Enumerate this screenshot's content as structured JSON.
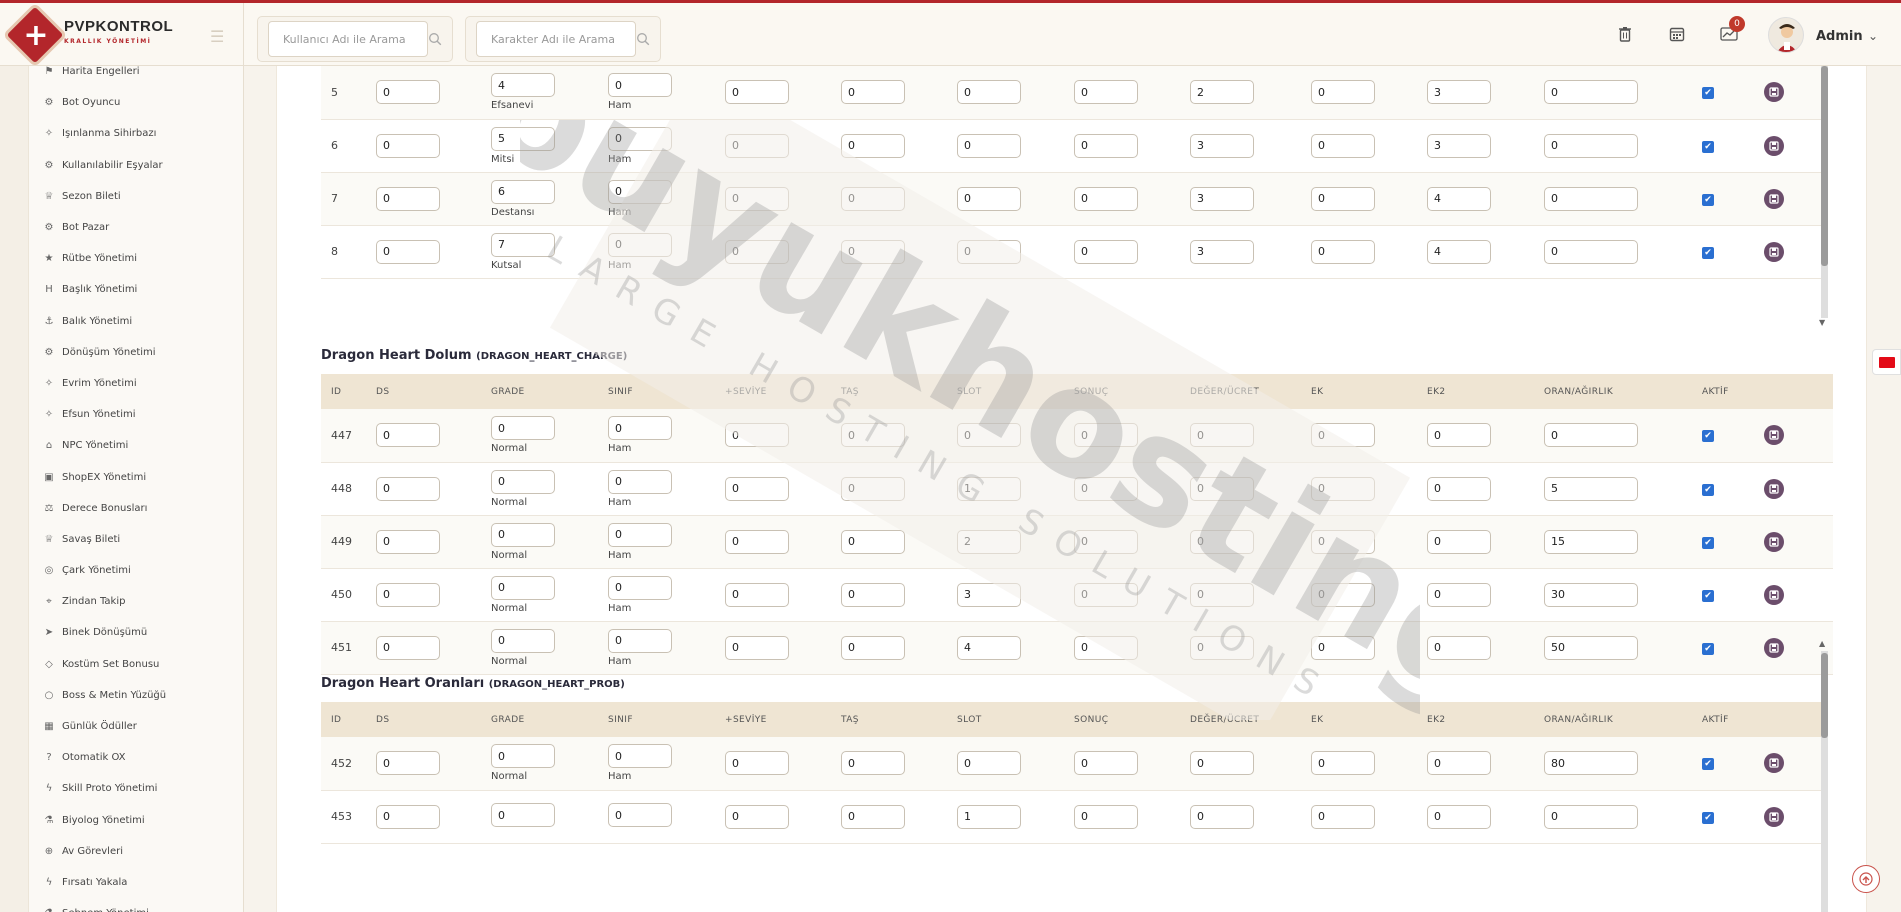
{
  "brand": {
    "name": "PVPKONTROL",
    "subtitle": "KRALLIK YÖNETİMİ"
  },
  "header": {
    "search_user_placeholder": "Kullanıcı Adı ile Arama",
    "search_char_placeholder": "Karakter Adı ile Arama",
    "notification_count": "0",
    "admin_name": "Admin"
  },
  "sidebar": {
    "items": [
      {
        "label": "Harita Engelleri",
        "icon": "map-icon"
      },
      {
        "label": "Bot Oyuncu",
        "icon": "robot-icon"
      },
      {
        "label": "Işınlanma Sihirbazı",
        "icon": "wand-icon"
      },
      {
        "label": "Kullanılabilir Eşyalar",
        "icon": "cogs-icon"
      },
      {
        "label": "Sezon Bileti",
        "icon": "trophy-icon"
      },
      {
        "label": "Bot Pazar",
        "icon": "robot-icon"
      },
      {
        "label": "Rütbe Yönetimi",
        "icon": "star-icon"
      },
      {
        "label": "Başlık Yönetimi",
        "icon": "heading-icon"
      },
      {
        "label": "Balık Yönetimi",
        "icon": "anchor-icon"
      },
      {
        "label": "Dönüşüm Yönetimi",
        "icon": "cogs-icon"
      },
      {
        "label": "Evrim Yönetimi",
        "icon": "wand-icon"
      },
      {
        "label": "Efsun Yönetimi",
        "icon": "wand-icon"
      },
      {
        "label": "NPC Yönetimi",
        "icon": "bank-icon"
      },
      {
        "label": "ShopEX Yönetimi",
        "icon": "cube-icon"
      },
      {
        "label": "Derece Bonusları",
        "icon": "scale-icon"
      },
      {
        "label": "Savaş Bileti",
        "icon": "trophy-icon"
      },
      {
        "label": "Çark Yönetimi",
        "icon": "wheel-icon"
      },
      {
        "label": "Zindan Takip",
        "icon": "pin-icon"
      },
      {
        "label": "Binek Dönüşümü",
        "icon": "rocket-icon"
      },
      {
        "label": "Kostüm Set Bonusu",
        "icon": "gem-icon"
      },
      {
        "label": "Boss & Metin Yüzüğü",
        "icon": "ring-icon"
      },
      {
        "label": "Günlük Ödüller",
        "icon": "calendar-icon"
      },
      {
        "label": "Otomatik OX",
        "icon": "question-icon"
      },
      {
        "label": "Skill Proto Yönetimi",
        "icon": "bolt-icon"
      },
      {
        "label": "Biyolog Yönetimi",
        "icon": "flask-icon"
      },
      {
        "label": "Av Görevleri",
        "icon": "crosshair-icon"
      },
      {
        "label": "Fırsatı Yakala",
        "icon": "bolt-icon"
      },
      {
        "label": "Şebnem Yönetimi",
        "icon": "flask-icon"
      }
    ]
  },
  "top_table": {
    "rows": [
      {
        "id": "5",
        "ds": "0",
        "grade": "4",
        "grade_label": "Efsanevi",
        "sinif": "0",
        "sinif_label": "Ham",
        "c1": "0",
        "c2": "0",
        "c3": "0",
        "c4": "0",
        "c5": "2",
        "c6": "0",
        "c7": "3",
        "oran": "0"
      },
      {
        "id": "6",
        "ds": "0",
        "grade": "5",
        "grade_label": "Mitsi",
        "sinif": "0",
        "sinif_label": "Ham",
        "c1": "0",
        "c2": "0",
        "c3": "0",
        "c4": "0",
        "c5": "3",
        "c6": "0",
        "c7": "3",
        "oran": "0"
      },
      {
        "id": "7",
        "ds": "0",
        "grade": "6",
        "grade_label": "Destansı",
        "sinif": "0",
        "sinif_label": "Ham",
        "c1": "0",
        "c2": "0",
        "c3": "0",
        "c4": "0",
        "c5": "3",
        "c6": "0",
        "c7": "4",
        "oran": "0"
      },
      {
        "id": "8",
        "ds": "0",
        "grade": "7",
        "grade_label": "Kutsal",
        "sinif": "0",
        "sinif_label": "Ham",
        "c1": "0",
        "c2": "0",
        "c3": "0",
        "c4": "0",
        "c5": "3",
        "c6": "0",
        "c7": "4",
        "oran": "0"
      }
    ]
  },
  "columns": [
    "ID",
    "DS",
    "GRADE",
    "SINIF",
    "+SEVİYE",
    "TAŞ",
    "SLOT",
    "SONUÇ",
    "DEĞER/ÜCRET",
    "EK",
    "EK2",
    "ORAN/AĞIRLIK",
    "AKTİF"
  ],
  "section1": {
    "title": "Dragon Heart Dolum",
    "code": "(DRAGON_HEART_CHARGE)",
    "rows": [
      {
        "id": "447",
        "ds": "0",
        "grade": "0",
        "grade_label": "Normal",
        "sinif": "0",
        "sinif_label": "Ham",
        "seviye": "0",
        "tas": "0",
        "slot": "0",
        "sonuc": "0",
        "deger": "0",
        "ek": "0",
        "ek2": "0",
        "oran": "0"
      },
      {
        "id": "448",
        "ds": "0",
        "grade": "0",
        "grade_label": "Normal",
        "sinif": "0",
        "sinif_label": "Ham",
        "seviye": "0",
        "tas": "0",
        "slot": "1",
        "sonuc": "0",
        "deger": "0",
        "ek": "0",
        "ek2": "0",
        "oran": "5"
      },
      {
        "id": "449",
        "ds": "0",
        "grade": "0",
        "grade_label": "Normal",
        "sinif": "0",
        "sinif_label": "Ham",
        "seviye": "0",
        "tas": "0",
        "slot": "2",
        "sonuc": "0",
        "deger": "0",
        "ek": "0",
        "ek2": "0",
        "oran": "15"
      },
      {
        "id": "450",
        "ds": "0",
        "grade": "0",
        "grade_label": "Normal",
        "sinif": "0",
        "sinif_label": "Ham",
        "seviye": "0",
        "tas": "0",
        "slot": "3",
        "sonuc": "0",
        "deger": "0",
        "ek": "0",
        "ek2": "0",
        "oran": "30"
      },
      {
        "id": "451",
        "ds": "0",
        "grade": "0",
        "grade_label": "Normal",
        "sinif": "0",
        "sinif_label": "Ham",
        "seviye": "0",
        "tas": "0",
        "slot": "4",
        "sonuc": "0",
        "deger": "0",
        "ek": "0",
        "ek2": "0",
        "oran": "50"
      }
    ]
  },
  "section2": {
    "title": "Dragon Heart Oranları",
    "code": "(DRAGON_HEART_PROB)",
    "rows": [
      {
        "id": "452",
        "ds": "0",
        "grade": "0",
        "grade_label": "Normal",
        "sinif": "0",
        "sinif_label": "Ham",
        "seviye": "0",
        "tas": "0",
        "slot": "0",
        "sonuc": "0",
        "deger": "0",
        "ek": "0",
        "ek2": "0",
        "oran": "80"
      },
      {
        "id": "453",
        "ds": "0",
        "grade": "0",
        "grade_label": "",
        "sinif": "0",
        "sinif_label": "",
        "seviye": "0",
        "tas": "0",
        "slot": "1",
        "sonuc": "0",
        "deger": "0",
        "ek": "0",
        "ek2": "0",
        "oran": "0"
      }
    ]
  },
  "watermark": {
    "main": "buyukhosting",
    "sub": "LARGE HOSTING SOLUTIONS"
  },
  "colors": {
    "brand": "#b3262b",
    "save": "#6b4d6b",
    "check": "#2a6fd1",
    "header_row": "#efe5d3"
  }
}
